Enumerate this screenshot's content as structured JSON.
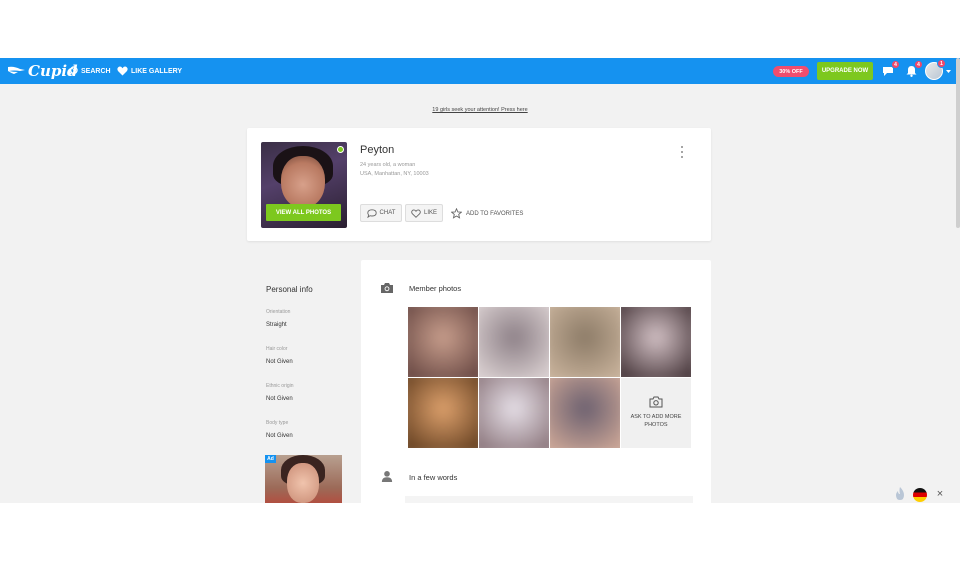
{
  "app": {
    "logo_text": "Cupid"
  },
  "topbar": {
    "nav": [
      {
        "label": "SEARCH",
        "icon": "search-icon"
      },
      {
        "label": "LIKE GALLERY",
        "icon": "heart-icon"
      }
    ],
    "discount": "30% OFF",
    "upgrade_label": "UPGRADE NOW",
    "messages_badge": "4",
    "notifications_badge": "4",
    "avatar_badge": "1",
    "accent_color": "#1592f0"
  },
  "attention_text": "19 girls seek your attention! Press here",
  "profile": {
    "name": "Peyton",
    "age_gender": "24 years old, a woman",
    "location": "USA, Manhattan, NY, 10003",
    "view_photos_label": "VIEW ALL PHOTOS",
    "online": true,
    "actions": {
      "chat_label": "CHAT",
      "like_label": "LIKE",
      "favorites_label": "ADD TO FAVORITES"
    }
  },
  "personal_info": {
    "title": "Personal info",
    "fields": [
      {
        "label": "Orientation",
        "value": "Straight"
      },
      {
        "label": "Hair color",
        "value": "Not Given"
      },
      {
        "label": "Ethnic origin",
        "value": "Not Given"
      },
      {
        "label": "Body type",
        "value": "Not Given"
      }
    ],
    "ad_tag": "Ad"
  },
  "member_photos": {
    "title": "Member photos",
    "photos": [
      {
        "colors": [
          "#caa08e",
          "#6b4a45"
        ]
      },
      {
        "colors": [
          "#8c7f86",
          "#d9cfd0"
        ]
      },
      {
        "colors": [
          "#8b7a66",
          "#c7b19a"
        ]
      },
      {
        "colors": [
          "#d6c4c8",
          "#4a3a3e"
        ]
      },
      {
        "colors": [
          "#e0a36e",
          "#6a4424"
        ]
      },
      {
        "colors": [
          "#e8e2ea",
          "#8f7a80"
        ]
      },
      {
        "colors": [
          "#6a5f6f",
          "#c9a495"
        ]
      }
    ],
    "ask_more_label": "ASK TO ADD MORE PHOTOS"
  },
  "few_words": {
    "title": "In a few words"
  },
  "footer": {
    "language": "German",
    "close_label": "×"
  }
}
